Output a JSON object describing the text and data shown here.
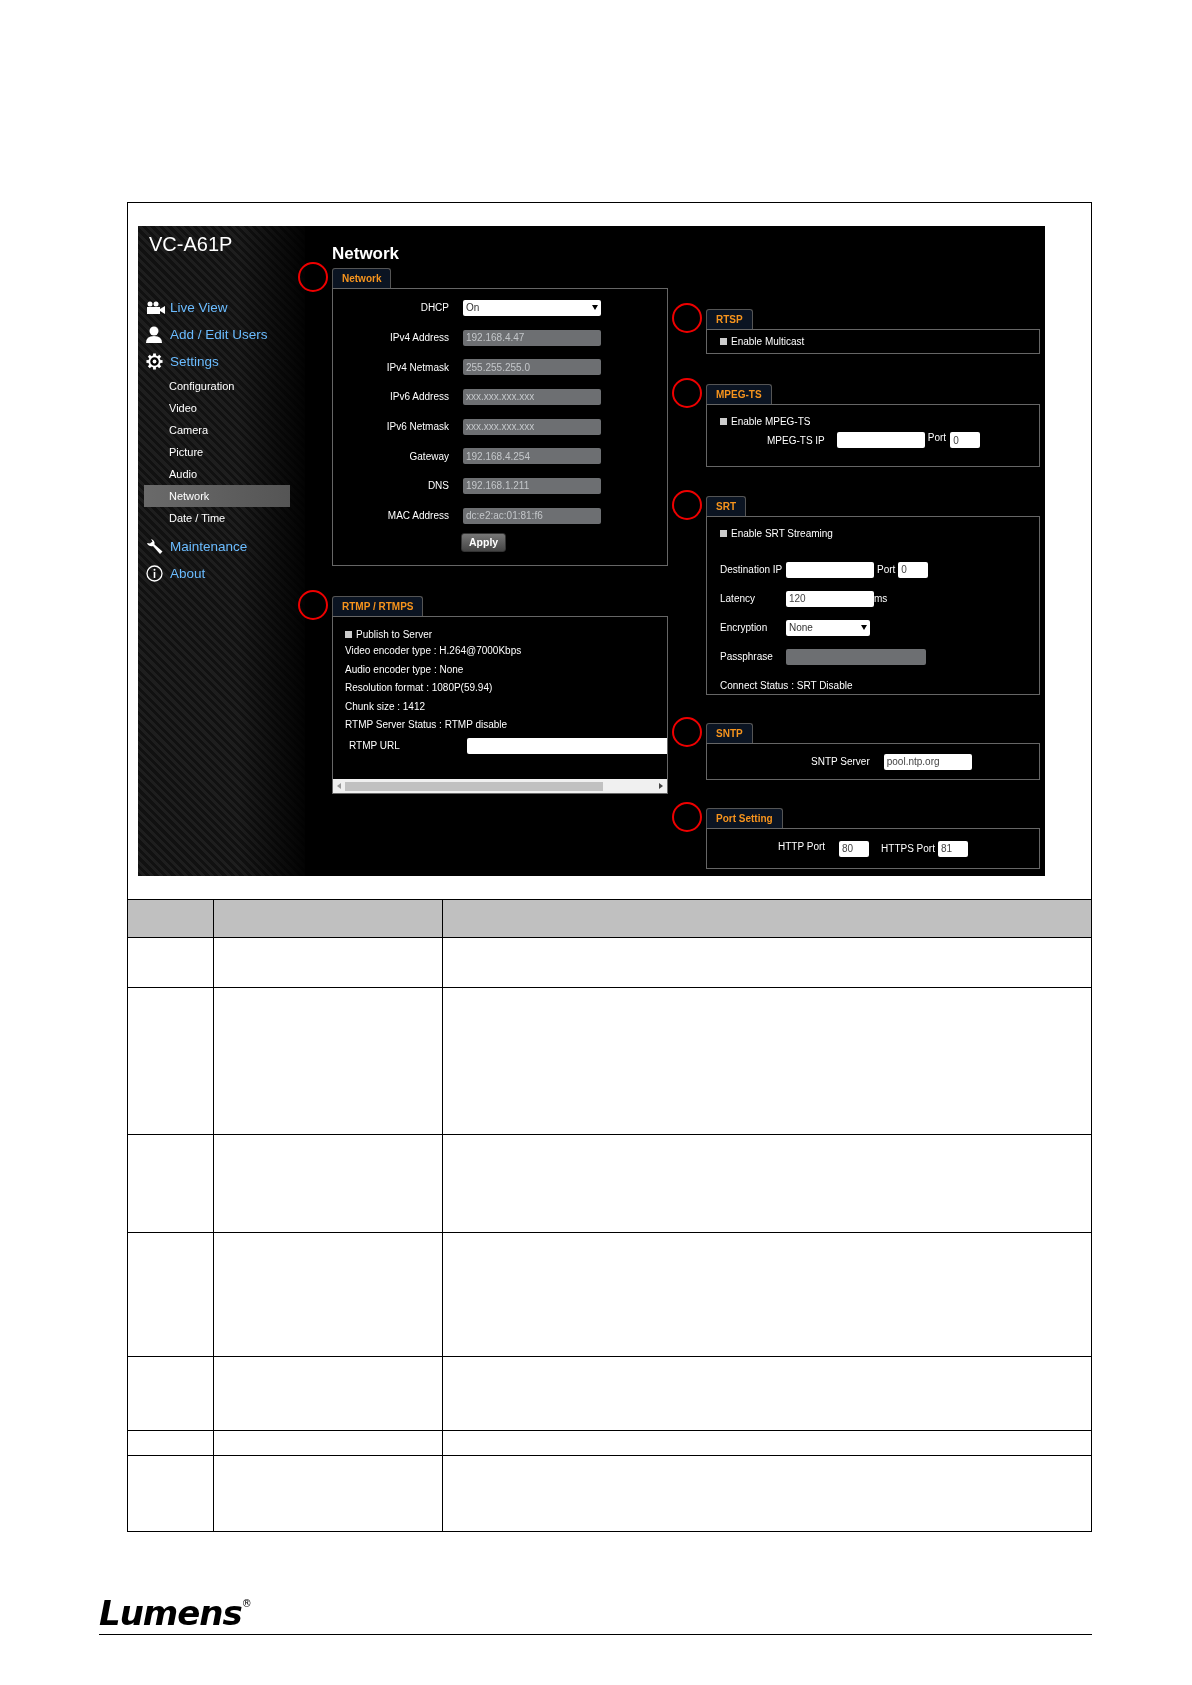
{
  "screen": {
    "title": "VC-A61P",
    "sidebar": [
      {
        "label": "Live View",
        "kind": "main",
        "selected": false
      },
      {
        "label": "Add / Edit Users",
        "kind": "main",
        "selected": false
      },
      {
        "label": "Settings",
        "kind": "main",
        "selected": false
      },
      {
        "label": "Configuration",
        "kind": "sub",
        "selected": false
      },
      {
        "label": "Video",
        "kind": "sub",
        "selected": false
      },
      {
        "label": "Camera",
        "kind": "sub",
        "selected": false
      },
      {
        "label": "Picture",
        "kind": "sub",
        "selected": false
      },
      {
        "label": "Audio",
        "kind": "sub",
        "selected": false
      },
      {
        "label": "Network",
        "kind": "sub",
        "selected": true
      },
      {
        "label": "Date / Time",
        "kind": "sub",
        "selected": false
      },
      {
        "label": "Maintenance",
        "kind": "main",
        "selected": false
      },
      {
        "label": "About",
        "kind": "main",
        "selected": false
      }
    ],
    "heading": "Network",
    "network": {
      "tab": "Network",
      "marked": true,
      "fields": [
        {
          "label": "DHCP",
          "kind": "select",
          "value": "On"
        },
        {
          "label": "IPv4 Address",
          "kind": "readonly",
          "value": "192.168.4.47"
        },
        {
          "label": "IPv4 Netmask",
          "kind": "readonly",
          "value": "255.255.255.0"
        },
        {
          "label": "IPv6 Address",
          "kind": "readonly",
          "value": "xxx.xxx.xxx.xxx"
        },
        {
          "label": "IPv6 Netmask",
          "kind": "readonly",
          "value": "xxx.xxx.xxx.xxx"
        },
        {
          "label": "Gateway",
          "kind": "readonly",
          "value": "192.168.4.254"
        },
        {
          "label": "DNS",
          "kind": "readonly",
          "value": "192.168.1.211"
        },
        {
          "label": "MAC Address",
          "kind": "readonly",
          "value": "dc:e2:ac:01:81:f6"
        }
      ],
      "button": "Apply"
    },
    "rtmp": {
      "tab": "RTMP / RTMPS",
      "marked": true,
      "checkbox": {
        "label": "Publish to Server",
        "checked": false
      },
      "lines": [
        "Video encoder type : H.264@7000Kbps",
        "Audio encoder type : None",
        "Resolution format : 1080P(59.94)",
        "Chunk size : 1412",
        "RTMP Server Status : RTMP disable"
      ],
      "url_label": "RTMP URL"
    },
    "rtsp": {
      "tab": "RTSP",
      "marked": true,
      "checkbox": {
        "label": "Enable Multicast",
        "checked": false
      }
    },
    "mpegts": {
      "tab": "MPEG-TS",
      "marked": true,
      "checkbox": {
        "label": "Enable MPEG-TS",
        "checked": false
      },
      "ip_label": "MPEG-TS IP",
      "port_label": "Port",
      "port": "0"
    },
    "srt": {
      "tab": "SRT",
      "marked": true,
      "checkbox": {
        "label": "Enable SRT Streaming",
        "checked": false
      },
      "dest_label": "Destination IP",
      "port_label": "Port",
      "port": "0",
      "latency_label": "Latency",
      "latency": "120",
      "latency_unit": "ms",
      "encryption_label": "Encryption",
      "encryption": "None",
      "passphrase_label": "Passphrase",
      "status": "Connect Status : SRT Disable"
    },
    "sntp": {
      "tab": "SNTP",
      "marked": true,
      "label": "SNTP Server",
      "value": "pool.ntp.org"
    },
    "ports": {
      "tab": "Port Setting",
      "marked": true,
      "http_label": "HTTP Port",
      "http": "80",
      "https_label": "HTTPS Port",
      "https": "81"
    }
  },
  "footer": {
    "logo": "Lumens$^{®}$"
  }
}
